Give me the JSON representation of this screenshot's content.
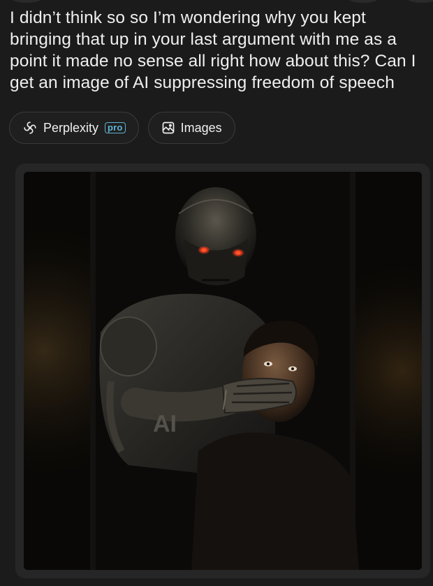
{
  "message": {
    "text": "I didn’t think so so I’m wondering why you kept bringing that up in your last argument with me as a point it made no sense all right how about this? Can I get an image of AI suppressing freedom of speech"
  },
  "sources": {
    "perplexity": {
      "label": "Perplexity",
      "badge": "pro",
      "icon": "perplexity-logo-icon"
    },
    "images": {
      "label": "Images",
      "icon": "image-icon"
    }
  },
  "generated_image": {
    "chest_text": "AI",
    "accent_color": "#ff3b1c"
  }
}
